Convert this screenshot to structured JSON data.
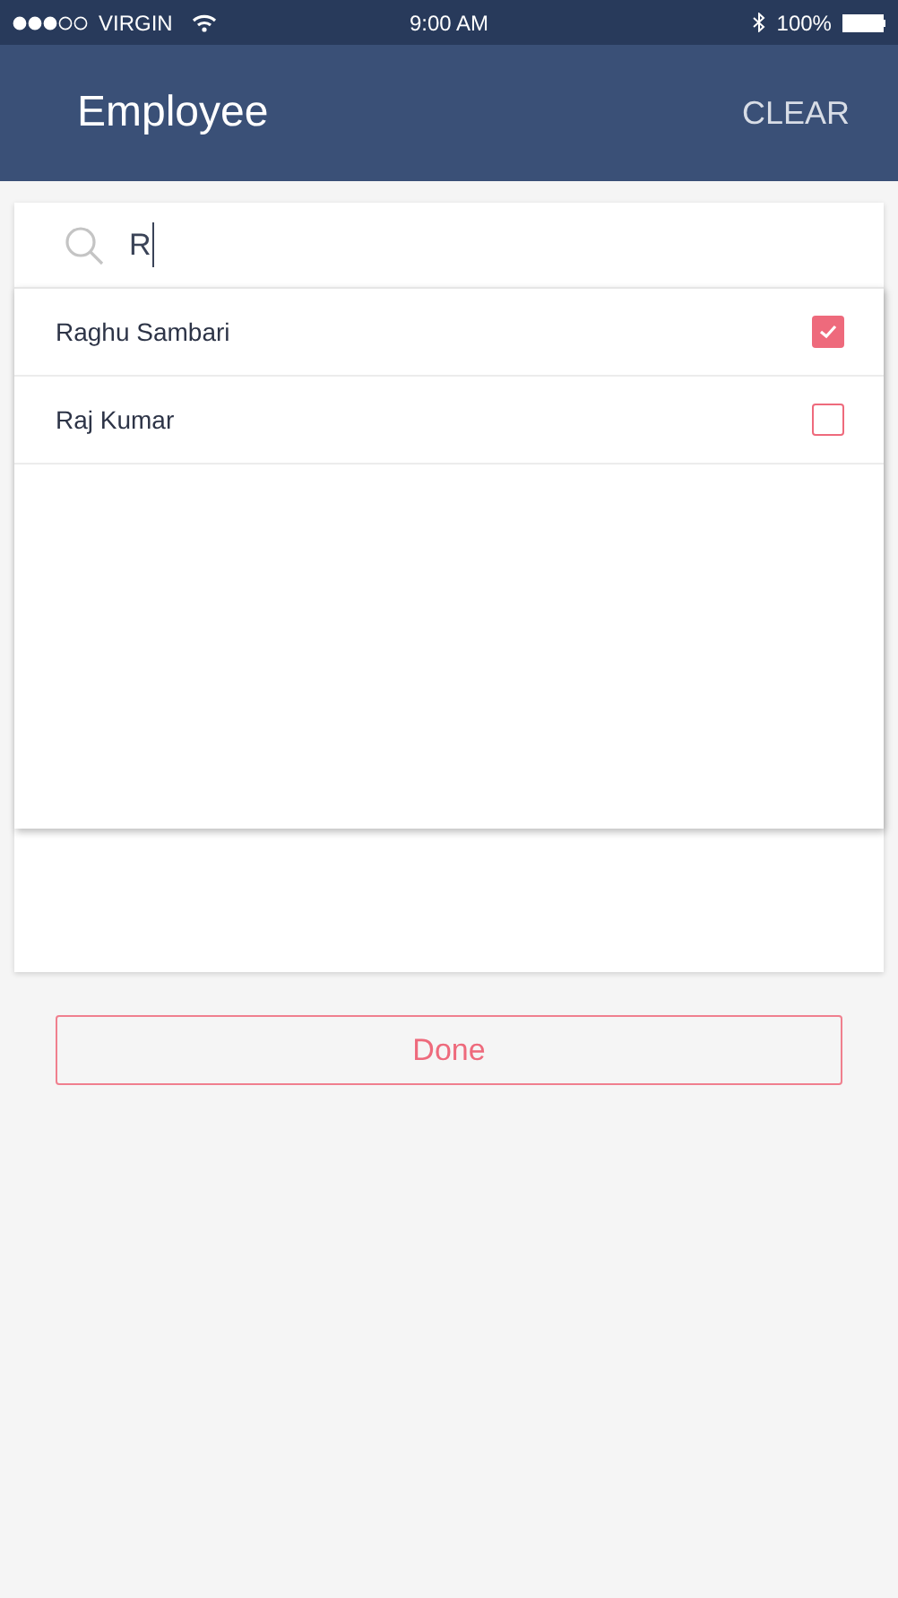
{
  "status_bar": {
    "carrier": "VIRGIN",
    "time": "9:00 AM",
    "battery": "100%"
  },
  "header": {
    "title": "Employee",
    "action": "CLEAR"
  },
  "search": {
    "value": "R"
  },
  "results": [
    {
      "name": "Raghu Sambari",
      "checked": true
    },
    {
      "name": "Raj Kumar",
      "checked": false
    }
  ],
  "done_button": "Done"
}
